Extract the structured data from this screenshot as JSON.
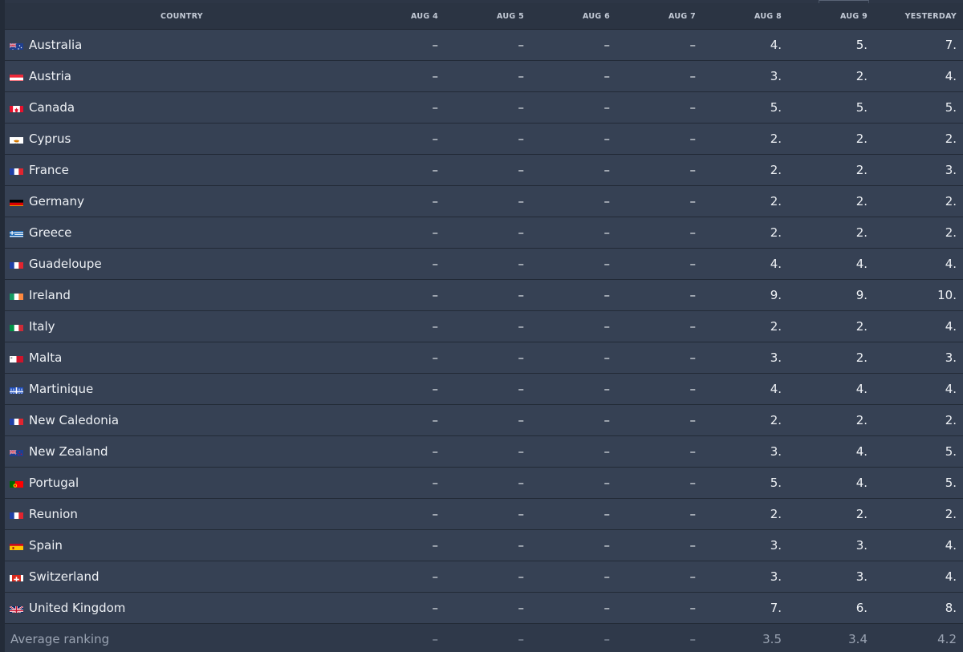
{
  "columns": {
    "country": "COUNTRY",
    "days": [
      "AUG 4",
      "AUG 5",
      "AUG 6",
      "AUG 7",
      "AUG 8",
      "AUG 9",
      "YESTERDAY"
    ]
  },
  "rows": [
    {
      "country": "Australia",
      "flag": "australia-flag-icon",
      "values": [
        "–",
        "–",
        "–",
        "–",
        "4.",
        "5.",
        "7."
      ]
    },
    {
      "country": "Austria",
      "flag": "austria-flag-icon",
      "values": [
        "–",
        "–",
        "–",
        "–",
        "3.",
        "2.",
        "4."
      ]
    },
    {
      "country": "Canada",
      "flag": "canada-flag-icon",
      "values": [
        "–",
        "–",
        "–",
        "–",
        "5.",
        "5.",
        "5."
      ]
    },
    {
      "country": "Cyprus",
      "flag": "cyprus-flag-icon",
      "values": [
        "–",
        "–",
        "–",
        "–",
        "2.",
        "2.",
        "2."
      ]
    },
    {
      "country": "France",
      "flag": "france-flag-icon",
      "values": [
        "–",
        "–",
        "–",
        "–",
        "2.",
        "2.",
        "3."
      ]
    },
    {
      "country": "Germany",
      "flag": "germany-flag-icon",
      "values": [
        "–",
        "–",
        "–",
        "–",
        "2.",
        "2.",
        "2."
      ]
    },
    {
      "country": "Greece",
      "flag": "greece-flag-icon",
      "values": [
        "–",
        "–",
        "–",
        "–",
        "2.",
        "2.",
        "2."
      ]
    },
    {
      "country": "Guadeloupe",
      "flag": "guadeloupe-flag-icon",
      "values": [
        "–",
        "–",
        "–",
        "–",
        "4.",
        "4.",
        "4."
      ]
    },
    {
      "country": "Ireland",
      "flag": "ireland-flag-icon",
      "values": [
        "–",
        "–",
        "–",
        "–",
        "9.",
        "9.",
        "10."
      ]
    },
    {
      "country": "Italy",
      "flag": "italy-flag-icon",
      "values": [
        "–",
        "–",
        "–",
        "–",
        "2.",
        "2.",
        "4."
      ]
    },
    {
      "country": "Malta",
      "flag": "malta-flag-icon",
      "values": [
        "–",
        "–",
        "–",
        "–",
        "3.",
        "2.",
        "3."
      ]
    },
    {
      "country": "Martinique",
      "flag": "martinique-flag-icon",
      "values": [
        "–",
        "–",
        "–",
        "–",
        "4.",
        "4.",
        "4."
      ]
    },
    {
      "country": "New Caledonia",
      "flag": "new-caledonia-flag-icon",
      "values": [
        "–",
        "–",
        "–",
        "–",
        "2.",
        "2.",
        "2."
      ]
    },
    {
      "country": "New Zealand",
      "flag": "new-zealand-flag-icon",
      "values": [
        "–",
        "–",
        "–",
        "–",
        "3.",
        "4.",
        "5."
      ]
    },
    {
      "country": "Portugal",
      "flag": "portugal-flag-icon",
      "values": [
        "–",
        "–",
        "–",
        "–",
        "5.",
        "4.",
        "5."
      ]
    },
    {
      "country": "Reunion",
      "flag": "reunion-flag-icon",
      "values": [
        "–",
        "–",
        "–",
        "–",
        "2.",
        "2.",
        "2."
      ]
    },
    {
      "country": "Spain",
      "flag": "spain-flag-icon",
      "values": [
        "–",
        "–",
        "–",
        "–",
        "3.",
        "3.",
        "4."
      ]
    },
    {
      "country": "Switzerland",
      "flag": "switzerland-flag-icon",
      "values": [
        "–",
        "–",
        "–",
        "–",
        "3.",
        "3.",
        "4."
      ]
    },
    {
      "country": "United Kingdom",
      "flag": "united-kingdom-flag-icon",
      "values": [
        "–",
        "–",
        "–",
        "–",
        "7.",
        "6.",
        "8."
      ]
    }
  ],
  "average": {
    "label": "Average ranking",
    "values": [
      "–",
      "–",
      "–",
      "–",
      "3.5",
      "3.4",
      "4.2"
    ]
  },
  "colors": {
    "background": "#2d3646",
    "row": "#364154",
    "header_text": "#c3cad6",
    "muted_text": "#9aa3b2"
  }
}
